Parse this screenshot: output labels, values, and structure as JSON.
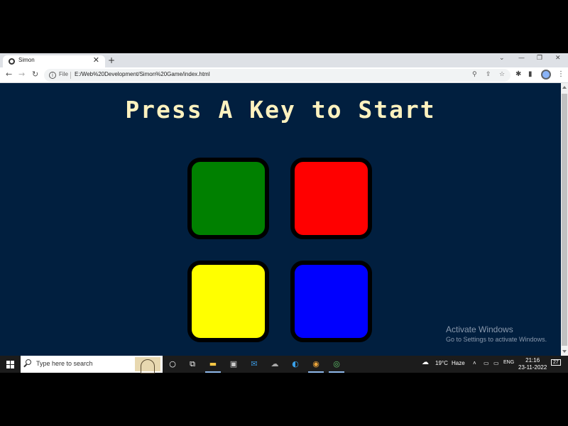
{
  "browser": {
    "tab_title": "Simon",
    "tab_close": "✕",
    "new_tab": "+",
    "url_scheme": "File",
    "url": "E:/Web%20Development/Simon%20Game/index.html",
    "icons": [
      "back-icon",
      "forward-icon",
      "reload-icon",
      "info-icon",
      "zoom-icon",
      "share-icon",
      "star-icon",
      "extensions-icon",
      "sidebar-icon",
      "profile-icon",
      "menu-icon"
    ],
    "window_controls": [
      "chevron-down-icon",
      "minimize-icon",
      "restore-icon",
      "close-icon"
    ]
  },
  "game": {
    "title": "Press A Key to Start",
    "background": "#011f3f",
    "title_color": "#fef2bf",
    "buttons": [
      {
        "id": "green",
        "color": "#008000"
      },
      {
        "id": "red",
        "color": "#ff0000"
      },
      {
        "id": "yellow",
        "color": "#ffff00"
      },
      {
        "id": "blue",
        "color": "#0000ff"
      }
    ]
  },
  "watermark": {
    "title": "Activate Windows",
    "subtitle": "Go to Settings to activate Windows."
  },
  "taskbar": {
    "search_placeholder": "Type here to search",
    "weather_temp": "19°C",
    "weather_desc": "Haze",
    "language": "ENG",
    "time": "21:16",
    "date": "23-11-2022",
    "notification_count": "27"
  }
}
